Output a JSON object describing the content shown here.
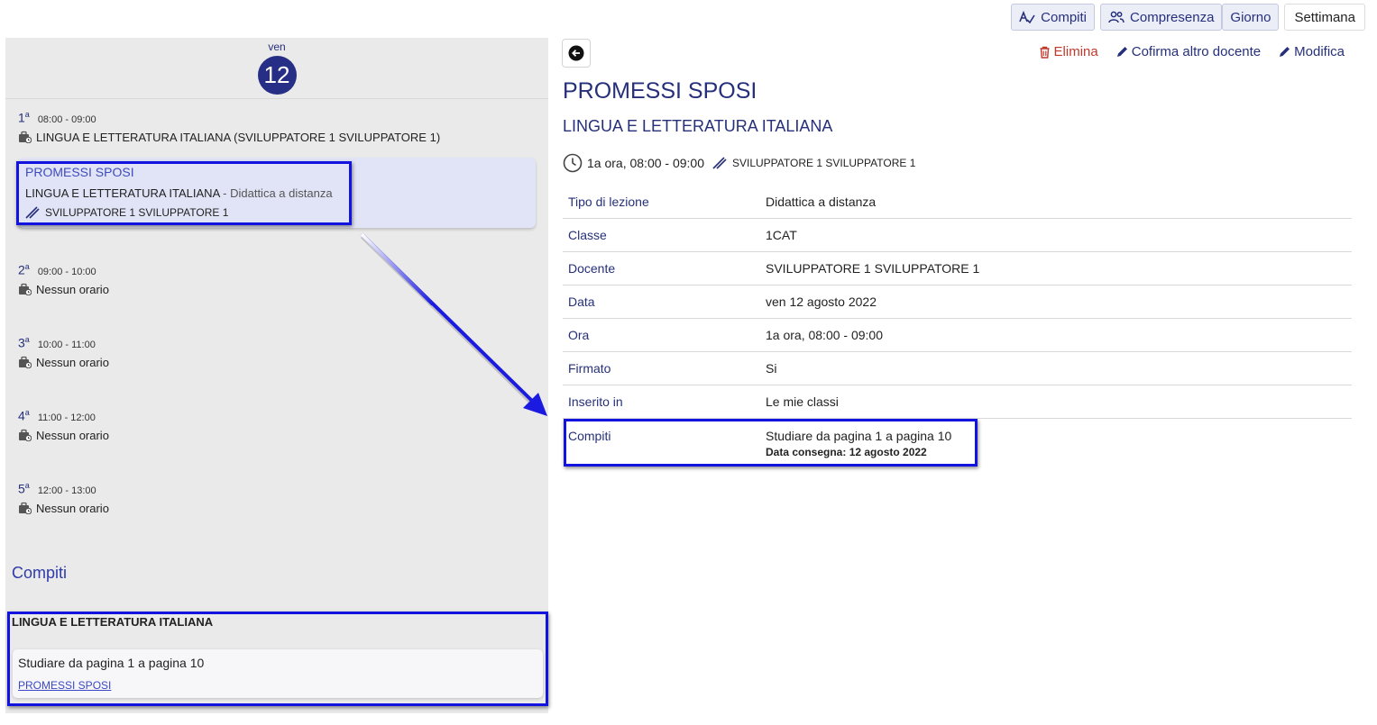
{
  "toolbar": {
    "compiti_label": "Compiti",
    "compresenza_label": "Compresenza",
    "giorno_label": "Giorno",
    "settimana_label": "Settimana"
  },
  "day": {
    "weekday": "ven",
    "number": "12"
  },
  "slots": [
    {
      "num": "1",
      "time": "08:00 - 09:00",
      "text": "LINGUA E LETTERATURA ITALIANA (SVILUPPATORE 1 SVILUPPATORE 1)"
    },
    {
      "num": "2",
      "time": "09:00 - 10:00",
      "text": "Nessun orario"
    },
    {
      "num": "3",
      "time": "10:00 - 11:00",
      "text": "Nessun orario"
    },
    {
      "num": "4",
      "time": "11:00 - 12:00",
      "text": "Nessun orario"
    },
    {
      "num": "5",
      "time": "12:00 - 13:00",
      "text": "Nessun orario"
    }
  ],
  "lesson_card": {
    "title": "PROMESSI SPOSI",
    "subject": "LINGUA E LETTERATURA ITALIANA",
    "type": "- Didattica a distanza",
    "teacher": "SVILUPPATORE 1 SVILUPPATORE 1"
  },
  "homework": {
    "heading": "Compiti",
    "subject": "LINGUA E LETTERATURA ITALIANA",
    "text": "Studiare da pagina 1 a pagina 10",
    "link": "PROMESSI SPOSI"
  },
  "actions": {
    "delete": "Elimina",
    "confirm": "Cofirma altro docente",
    "edit": "Modifica"
  },
  "detail": {
    "title": "PROMESSI SPOSI",
    "subject": "LINGUA E LETTERATURA ITALIANA",
    "meta_time": "1a ora, 08:00 - 09:00",
    "meta_teacher": "SVILUPPATORE 1 SVILUPPATORE 1",
    "rows": [
      {
        "label": "Tipo di lezione",
        "value": "Didattica a distanza"
      },
      {
        "label": "Classe",
        "value": "1CAT"
      },
      {
        "label": "Docente",
        "value": "SVILUPPATORE 1 SVILUPPATORE 1"
      },
      {
        "label": "Data",
        "value": "ven 12 agosto 2022"
      },
      {
        "label": "Ora",
        "value": "1a ora, 08:00 - 09:00"
      },
      {
        "label": "Firmato",
        "value": "Si"
      },
      {
        "label": "Inserito in",
        "value": "Le mie classi"
      },
      {
        "label": "Compiti",
        "value": "Studiare da pagina 1 a pagina 10",
        "sub": "Data consegna: 12 agosto 2022"
      }
    ]
  },
  "colors": {
    "accent": "#26307a",
    "highlight": "#1313e0",
    "danger": "#c0392b"
  }
}
